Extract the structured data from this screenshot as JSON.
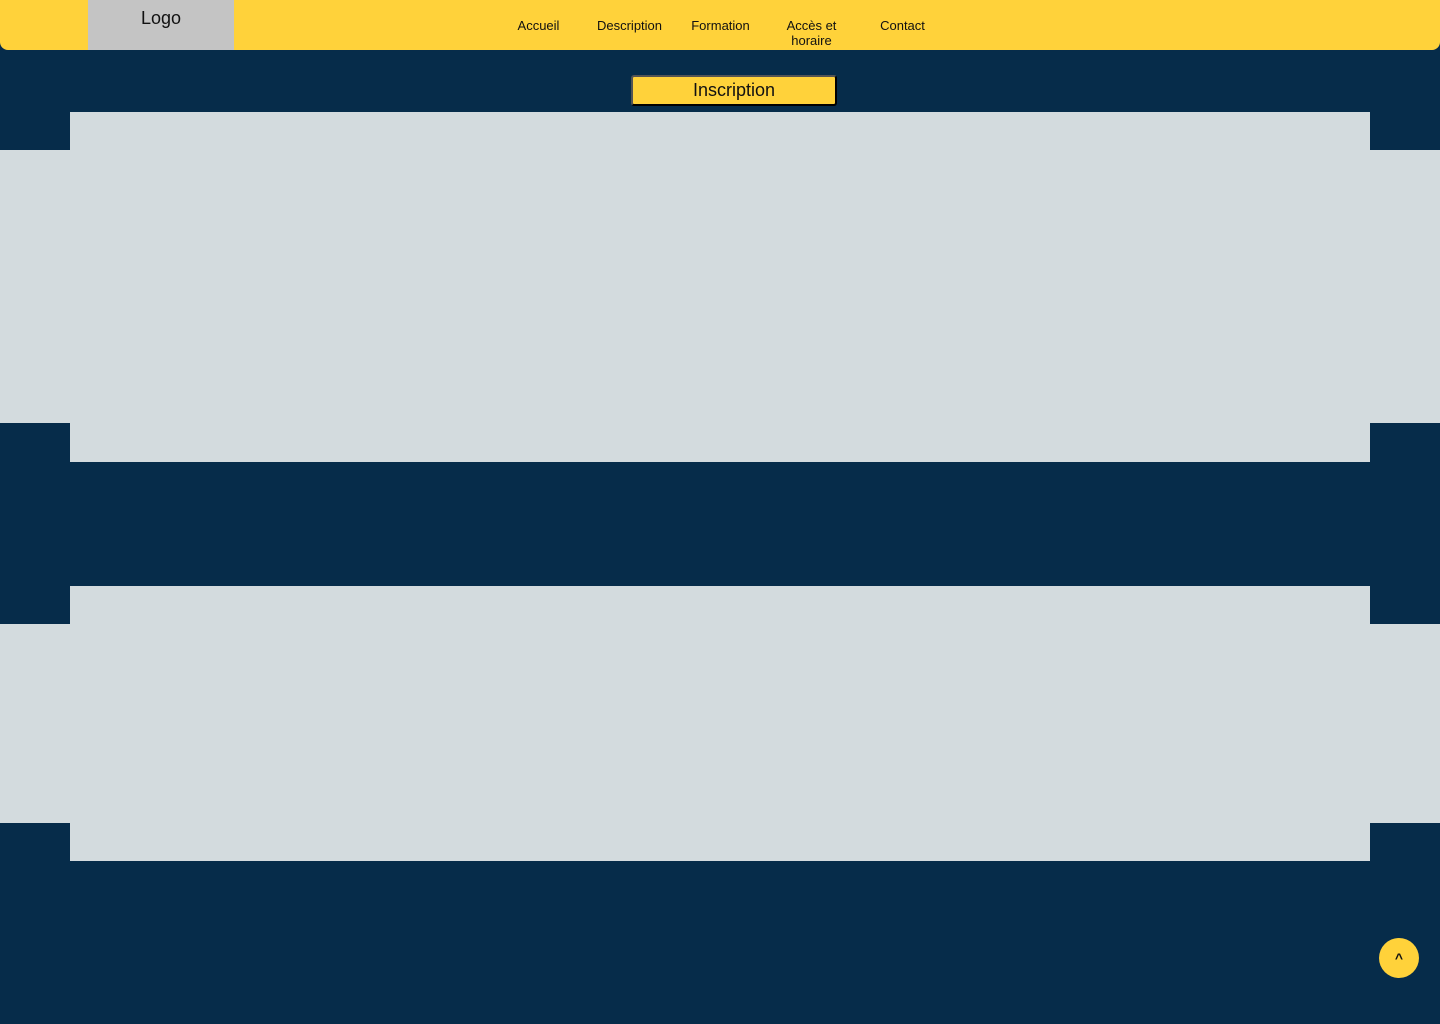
{
  "header": {
    "logo_text": "Logo",
    "nav": [
      "Accueil",
      "Description",
      "Formation",
      "Accès et horaire",
      "Contact"
    ]
  },
  "main": {
    "signup_label": "Inscription"
  },
  "footer": {
    "scroll_top_icon": "^"
  },
  "colors": {
    "primary_bg": "#062C4A",
    "accent": "#FFD23A",
    "panel": "#D3DBDE",
    "logo_bg": "#C4C4C4"
  }
}
